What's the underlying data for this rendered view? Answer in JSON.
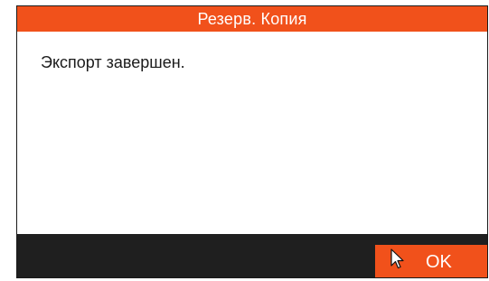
{
  "dialog": {
    "title": "Резерв. Копия",
    "message": "Экспорт завершен.",
    "ok_label": "OK"
  },
  "icons": {
    "cursor": "mouse-pointer-icon"
  },
  "colors": {
    "accent": "#f1511b",
    "footer": "#1f1f1f",
    "body": "#ffffff"
  }
}
